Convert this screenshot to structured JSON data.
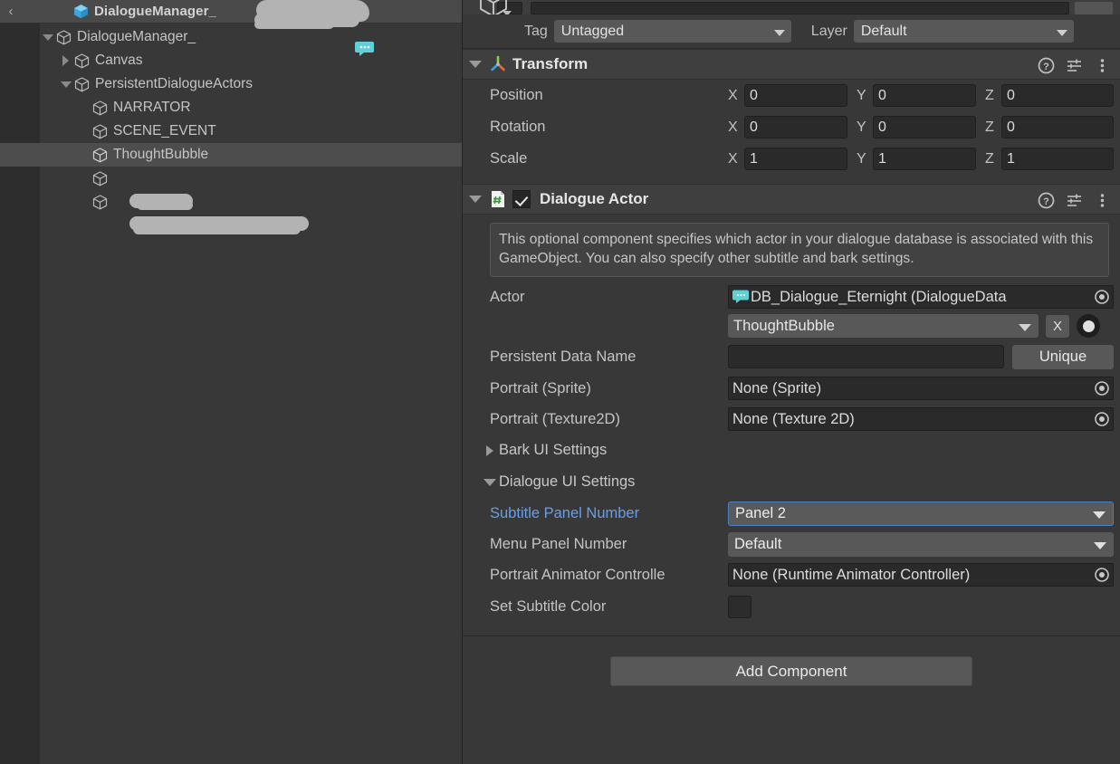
{
  "hierarchy": {
    "back_icon": "back-arrow-icon",
    "header_title": "DialogueManager_",
    "header_icon": "prefab-cube-icon",
    "rows": [
      {
        "label": "DialogueManager_",
        "indent": 1,
        "fold": "open",
        "redacted": true,
        "badge": "speech-bubble-icon"
      },
      {
        "label": "Canvas",
        "indent": 2,
        "fold": "closed",
        "redacted": false
      },
      {
        "label": "PersistentDialogueActors",
        "indent": 2,
        "fold": "open",
        "redacted": false
      },
      {
        "label": "NARRATOR",
        "indent": 3,
        "fold": "none",
        "redacted": false
      },
      {
        "label": "SCENE_EVENT",
        "indent": 3,
        "fold": "none",
        "redacted": false
      },
      {
        "label": "ThoughtBubble",
        "indent": 3,
        "fold": "none",
        "redacted": false,
        "selected": true
      },
      {
        "label": "",
        "indent": 3,
        "fold": "none",
        "redacted": true
      },
      {
        "label": "",
        "indent": 3,
        "fold": "none",
        "redacted": true
      }
    ]
  },
  "inspector": {
    "tag": {
      "label": "Tag",
      "value": "Untagged"
    },
    "layer": {
      "label": "Layer",
      "value": "Default"
    },
    "transform": {
      "title": "Transform",
      "icon": "transform-axis-icon",
      "help_icon": "help-icon",
      "preset_icon": "preset-icon",
      "menu_icon": "kebab-menu-icon",
      "rows": [
        {
          "label": "Position",
          "x": "0",
          "y": "0",
          "z": "0"
        },
        {
          "label": "Rotation",
          "x": "0",
          "y": "0",
          "z": "0"
        },
        {
          "label": "Scale",
          "x": "1",
          "y": "1",
          "z": "1"
        }
      ],
      "axes": [
        "X",
        "Y",
        "Z"
      ]
    },
    "dialogue_actor": {
      "title": "Dialogue Actor",
      "icon": "csharp-script-icon",
      "enabled": true,
      "help_text": "This optional component specifies which actor in your dialogue database is associated with this GameObject. You can also specify other subtitle and bark settings.",
      "actor": {
        "label": "Actor",
        "object_value": "DB_Dialogue_Eternight (DialogueData",
        "object_icon": "speech-bubble-icon",
        "picker_icon": "object-picker-icon",
        "dropdown_value": "ThoughtBubble",
        "clear_label": "X",
        "radio_icon": "radio-dot-icon"
      },
      "persistent_data_name": {
        "label": "Persistent Data Name",
        "value": "",
        "placeholder": "",
        "button_label": "Unique"
      },
      "portrait_sprite": {
        "label": "Portrait (Sprite)",
        "value": "None (Sprite)",
        "picker_icon": "object-picker-icon"
      },
      "portrait_texture": {
        "label": "Portrait (Texture2D)",
        "value": "None (Texture 2D)",
        "picker_icon": "object-picker-icon"
      },
      "bark_ui_settings": {
        "label": "Bark UI Settings",
        "state": "collapsed"
      },
      "dialogue_ui_settings": {
        "label": "Dialogue UI Settings",
        "state": "expanded"
      },
      "subtitle_panel_number": {
        "label": "Subtitle Panel Number",
        "value": "Panel 2",
        "modified": true,
        "focused": true
      },
      "menu_panel_number": {
        "label": "Menu Panel Number",
        "value": "Default"
      },
      "portrait_animator_controller": {
        "label": "Portrait Animator Controlle",
        "value": "None (Runtime Animator Controller)",
        "picker_icon": "object-picker-icon"
      },
      "set_subtitle_color": {
        "label": "Set Subtitle Color",
        "checked": false
      }
    },
    "add_component_label": "Add Component"
  },
  "colors": {
    "background": "#383838",
    "panel_header": "#4a4a4a",
    "selection": "#4d4d4d",
    "accent_blue": "#6a9ee8",
    "focus_border": "#4a7fc4",
    "prefab_cube": "#54b4e8",
    "speech_bubble": "#5fd0d8",
    "script_green": "#4a9e4a",
    "redaction": "#b3b3b3"
  }
}
